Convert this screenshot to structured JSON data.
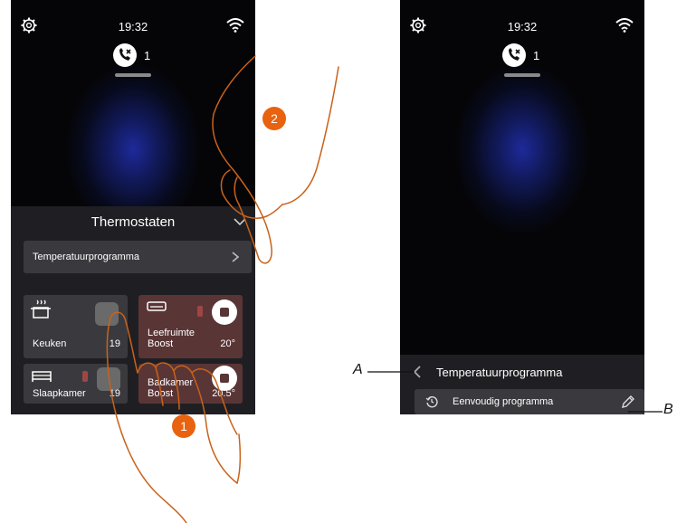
{
  "screen_left": {
    "status": {
      "time": "19:32"
    },
    "missed_calls": "1",
    "panel": {
      "title": "Thermostaten",
      "program_row": "Temperatuurprogramma",
      "tiles": [
        {
          "name": "Keuken",
          "temp": "19"
        },
        {
          "name": "Leefruimte\nBoost",
          "temp": "20°"
        },
        {
          "name": "Slaapkamer",
          "temp": "19"
        },
        {
          "name": "Badkamer\nBoost",
          "temp": "20.5°"
        }
      ]
    }
  },
  "screen_right": {
    "status": {
      "time": "19:32"
    },
    "missed_calls": "1",
    "panel": {
      "title": "Temperatuurprogramma",
      "item": "Eenvoudig programma"
    }
  },
  "annotations": {
    "a": "A",
    "b": "B",
    "step1": "1",
    "step2": "2"
  },
  "colors": {
    "accent": "#e8620f",
    "hand_stroke": "#c9621a"
  }
}
